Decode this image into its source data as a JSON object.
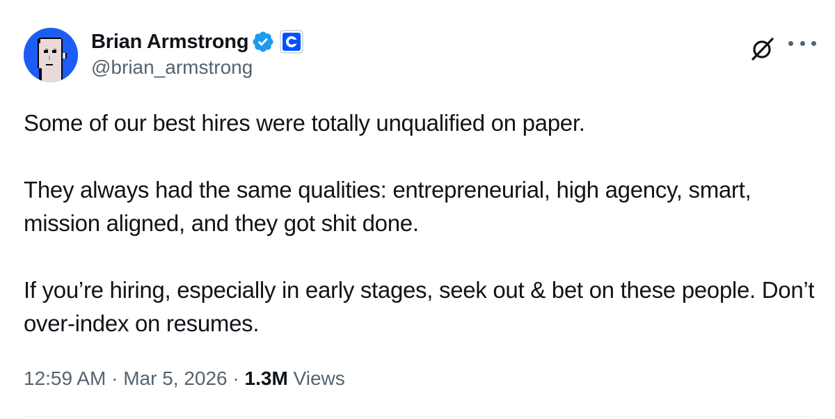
{
  "author": {
    "display_name": "Brian Armstrong",
    "handle": "@brian_armstrong",
    "verified_icon": "verified-badge-icon",
    "affiliate_icon": "coinbase-logo-icon",
    "avatar_icon": "pixel-punk-avatar"
  },
  "tweet": {
    "paragraphs": [
      "Some of our best hires were totally unqualified on paper.",
      "They always had the same qualities: entrepreneurial, high agency, smart, mission aligned, and they got shit done.",
      "If you’re hiring, especially in early stages, seek out & bet on these people. Don’t over-index on resumes."
    ],
    "time": "12:59 AM",
    "separator": "·",
    "date": "Mar 5, 2026",
    "views_count": "1.3M",
    "views_label": "Views"
  },
  "colors": {
    "accent": "#1d9bf0",
    "avatar_bg": "#1d5df5",
    "coinbase": "#0052ff",
    "secondary_text": "#536471",
    "primary_text": "#0f1419"
  }
}
